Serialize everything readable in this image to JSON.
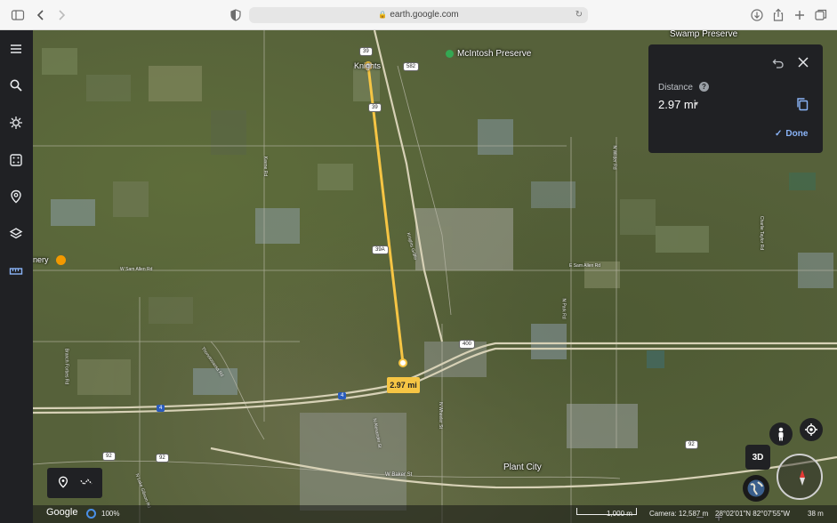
{
  "browser": {
    "url": "earth.google.com",
    "icons": [
      "sidebar-toggle-icon",
      "back-icon",
      "forward-icon",
      "shield-icon",
      "download-icon",
      "share-icon",
      "new-tab-icon",
      "tabs-icon",
      "reload-icon",
      "lock-icon"
    ]
  },
  "sidebar": {
    "items": [
      {
        "name": "menu-icon"
      },
      {
        "name": "search-icon"
      },
      {
        "name": "voyager-icon"
      },
      {
        "name": "feeling-lucky-icon"
      },
      {
        "name": "projects-icon"
      },
      {
        "name": "map-style-icon"
      },
      {
        "name": "measure-icon"
      }
    ]
  },
  "map": {
    "places": {
      "swamp_preserve": "Swamp Preserve",
      "mcintosh": "McIntosh Preserve",
      "knights": "Knights",
      "plant_city": "Plant City",
      "winery": "nery"
    },
    "roads": {
      "w_sam_allen": "W Sam Allen Rd",
      "e_sam_allen": "E Sam Allen Rd",
      "w_baker": "W Baker St",
      "thonotosassa": "Thonotosassa Rd",
      "knights_griffin": "Knights Griffin",
      "park_rd": "N Park Rd",
      "wilder_rd": "N Wilder Rd",
      "charlie_taylor": "Charlie Taylor Rd",
      "branch_forbes": "Branch Forbes Rd",
      "alexander": "N Alexander St",
      "wheeler": "N Wheeler St",
      "keene": "Keene Rd",
      "lake_gibson": "N Lake Gibson Rd"
    },
    "shields": {
      "r39_top": "39",
      "r582": "582",
      "r39_mid": "39",
      "r39a": "39A",
      "r400": "400",
      "r4_a": "4",
      "r4_b": "4",
      "r92_a": "92",
      "r92_b": "92",
      "r92_c": "92"
    },
    "measure_label": "2.97 mi",
    "measure_color": "#f6c544"
  },
  "panel": {
    "title": "Distance",
    "help": "?",
    "value": "2.97 mi",
    "caret": "▾",
    "done": "Done",
    "icons": [
      "undo-icon",
      "close-icon",
      "help-icon",
      "copy-icon",
      "check-icon",
      "dropdown-caret-icon"
    ]
  },
  "controls": {
    "three_d": "3D",
    "zoom_minus": "−",
    "zoom_plus": "+",
    "icons": [
      "pegman-icon",
      "my-location-icon",
      "globe-icon",
      "compass-icon",
      "placemark-icon",
      "path-icon"
    ]
  },
  "status": {
    "brand": "Google",
    "streaming": "100%",
    "scale": "1,000 m",
    "camera": "Camera: 12,587 m",
    "coords": "28°02'01\"N 82°07'55\"W",
    "elevation": "38 m"
  }
}
